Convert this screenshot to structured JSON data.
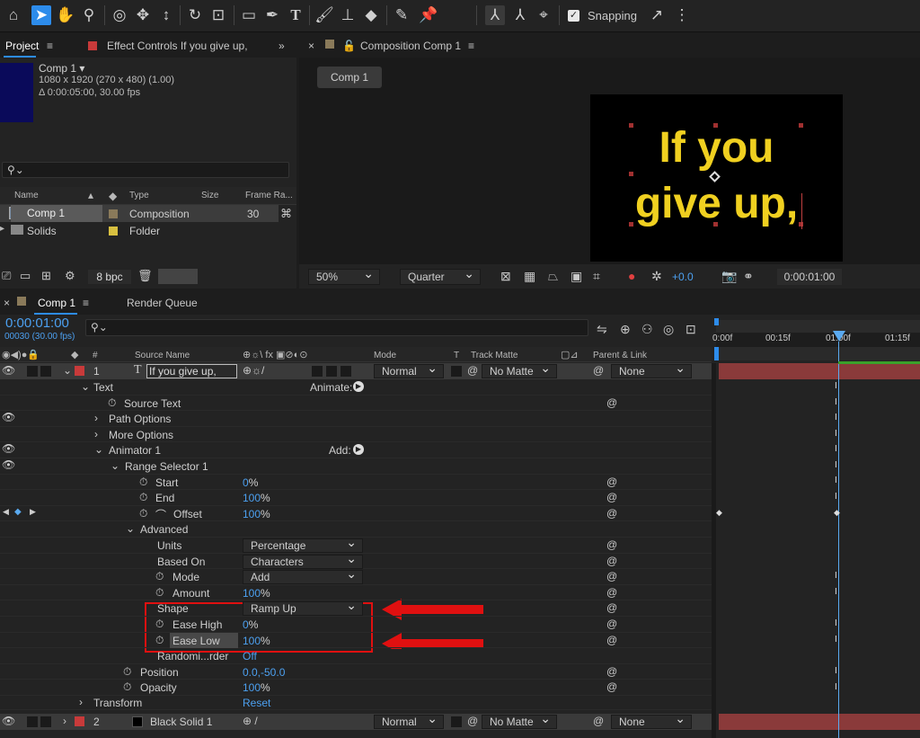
{
  "toolbar": {
    "snapping_label": "Snapping"
  },
  "project": {
    "tab_label": "Project",
    "effect_tab_label": "Effect Controls If you give up,",
    "comp_name": "Comp 1",
    "comp_dims": "1080 x 1920  (270 x 480) (1.00)",
    "comp_duration": "Δ 0:00:05:00, 30.00 fps",
    "search_placeholder": "",
    "columns": {
      "name": "Name",
      "type": "Type",
      "size": "Size",
      "frame_rate": "Frame Ra..."
    },
    "items": [
      {
        "name": "Comp 1",
        "type": "Composition",
        "frame_rate": "30",
        "color": "#8a7a5a"
      },
      {
        "name": "Solids",
        "type": "Folder",
        "frame_rate": "",
        "color": "#d8c040"
      }
    ],
    "bpc_label": "8 bpc"
  },
  "composition": {
    "tab_label": "Composition Comp 1",
    "crumb_label": "Comp 1",
    "viewer_text_line1": "If you",
    "viewer_text_line2": "give up,",
    "text_color": "#f0d020",
    "zoom": "50%",
    "resolution": "Quarter",
    "exposure": "+0.0",
    "timecode": "0:00:01:00"
  },
  "timeline": {
    "tab_label": "Comp 1",
    "render_queue_label": "Render Queue",
    "current_time": "0:00:01:00",
    "frame_info": "00030 (30.00 fps)",
    "search_placeholder": "",
    "columns": {
      "hash": "#",
      "source_name": "Source Name",
      "mode": "Mode",
      "t": "T",
      "track_matte": "Track Matte",
      "parent_link": "Parent & Link"
    },
    "ruler": {
      "t0": "0:00f",
      "t1": "00:15f",
      "t2": "01:00f",
      "t3": "01:15f"
    },
    "layer1": {
      "index": "1",
      "name": "If you give up,",
      "mode": "Normal",
      "matte": "No Matte",
      "parent": "None",
      "color": "#c83a3a"
    },
    "layer2": {
      "index": "2",
      "name": "Black Solid 1",
      "mode": "Normal",
      "matte": "No Matte",
      "parent": "None",
      "color": "#c83a3a"
    },
    "text_group": "Text",
    "animate_label": "Animate:",
    "source_text": "Source Text",
    "path_options": "Path Options",
    "more_options": "More Options",
    "animator": "Animator 1",
    "add_label": "Add:",
    "range_selector": "Range Selector 1",
    "start_label": "Start",
    "start_value": "0",
    "start_unit": "%",
    "end_label": "End",
    "end_value": "100",
    "end_unit": "%",
    "offset_label": "Offset",
    "offset_value": "100",
    "offset_unit": "%",
    "advanced": "Advanced",
    "units_label": "Units",
    "units_value": "Percentage",
    "based_on_label": "Based On",
    "based_on_value": "Characters",
    "mode_label": "Mode",
    "mode_value": "Add",
    "amount_label": "Amount",
    "amount_value": "100",
    "amount_unit": "%",
    "shape_label": "Shape",
    "shape_value": "Ramp Up",
    "ease_high_label": "Ease High",
    "ease_high_value": "0",
    "ease_high_unit": "%",
    "ease_low_label": "Ease Low",
    "ease_low_value": "100",
    "ease_low_unit": "%",
    "randomize_label": "Randomi...rder",
    "randomize_value": "Off",
    "position_label": "Position",
    "position_value": "0.0,-50.0",
    "opacity_label": "Opacity",
    "opacity_value": "100",
    "opacity_unit": "%",
    "transform_label": "Transform",
    "reset_label": "Reset"
  },
  "colors": {
    "accent": "#2d8ceb",
    "highlight": "#e01010",
    "value_blue": "#4ca0f0"
  }
}
